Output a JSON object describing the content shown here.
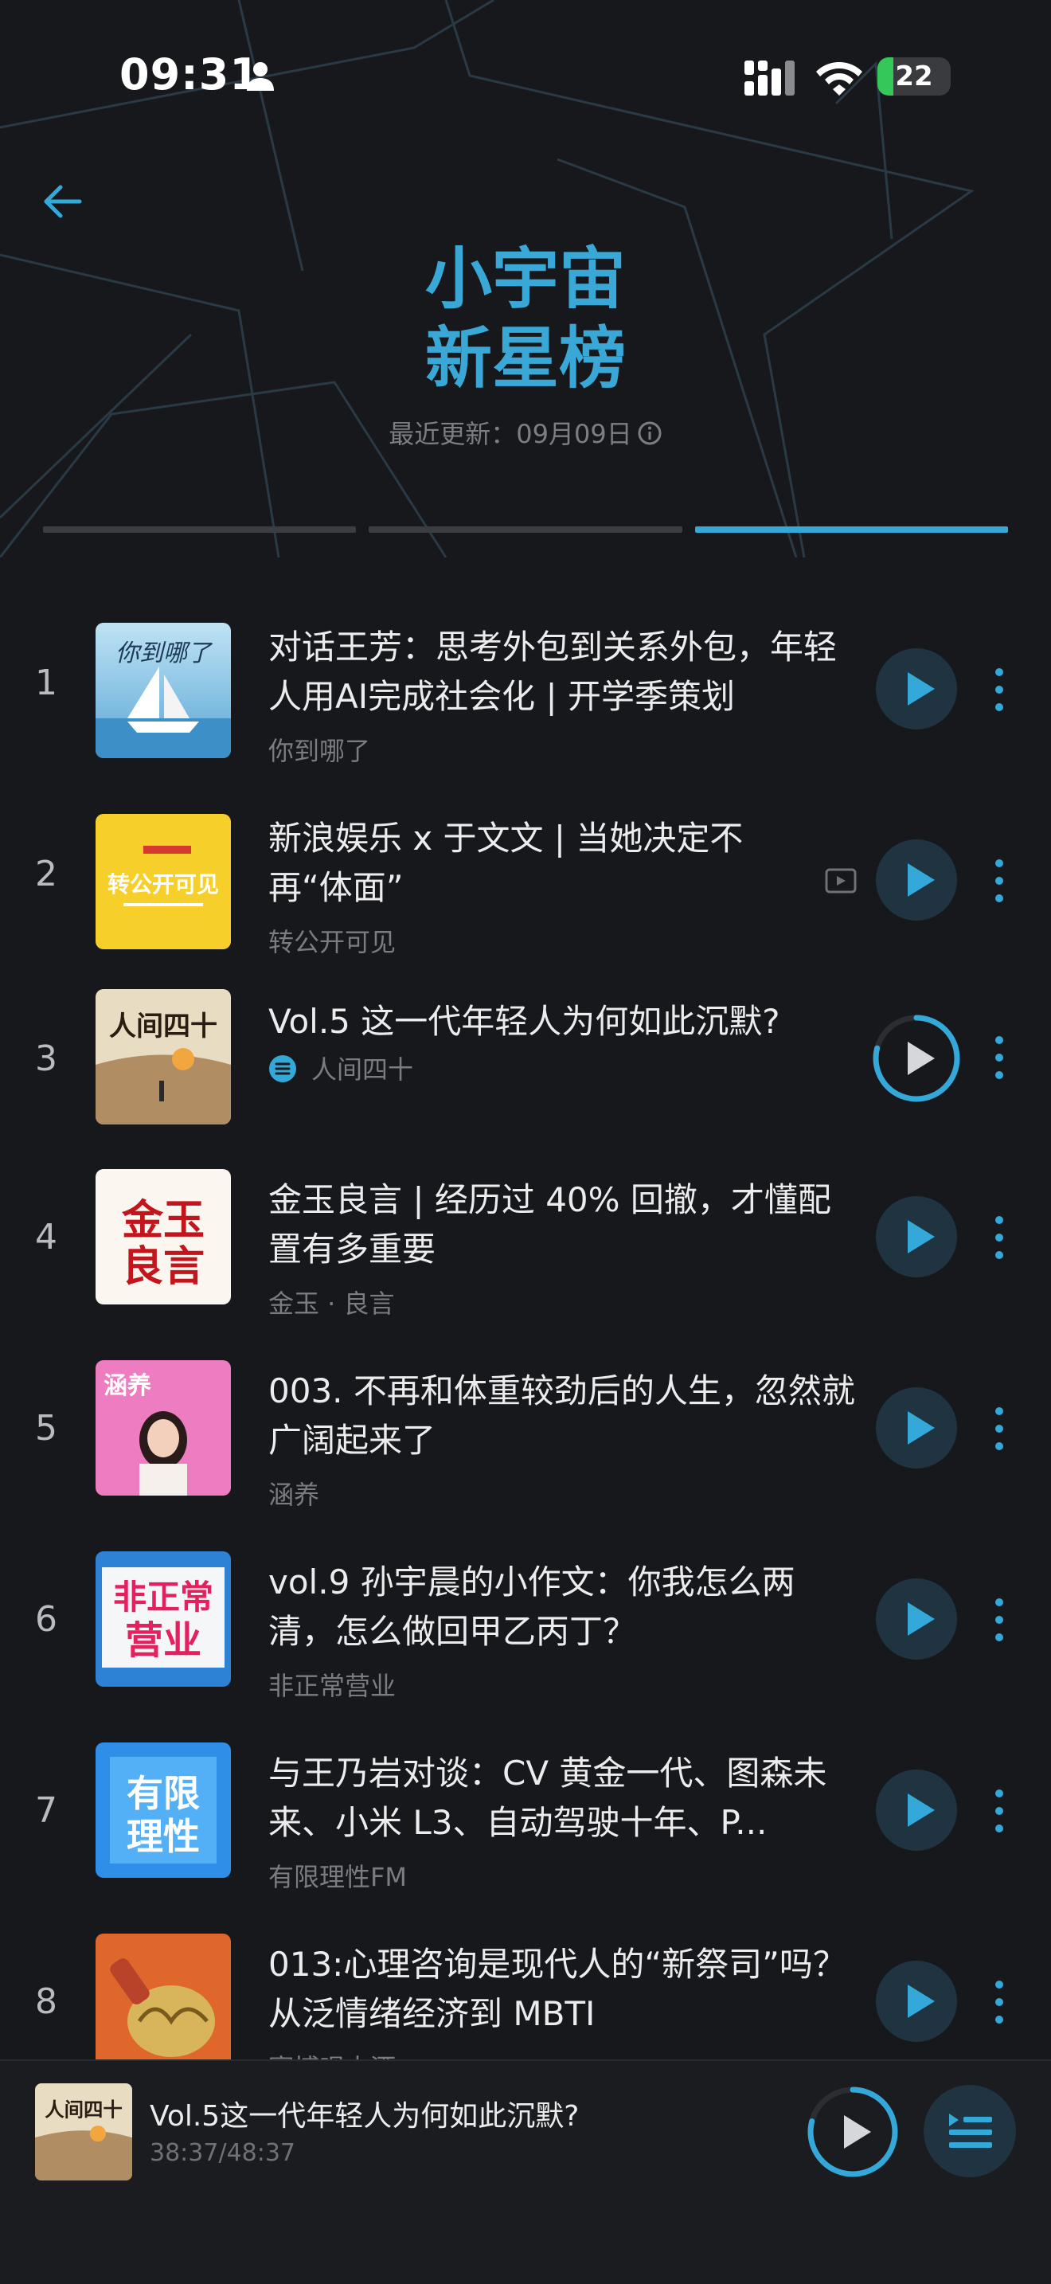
{
  "status_bar": {
    "time": "09:31",
    "battery": "22",
    "battery_level": 0.22
  },
  "header": {
    "title_line1": "小宇宙",
    "title_line2": "新星榜",
    "update_text": "最近更新：09月09日",
    "tabs_count": 3,
    "active_tab": 2
  },
  "colors": {
    "accent": "#34a9d9",
    "background": "#17181c",
    "battery_green": "#35c759"
  },
  "episodes": [
    {
      "rank": "1",
      "title": "对话王芳：思考外包到关系外包，年轻人用AI完成社会化 | 开学季策划",
      "podcast": "你到哪了",
      "cover_text": "你到哪了"
    },
    {
      "rank": "2",
      "title": "新浪娱乐 x 于文文 | 当她决定不再“体面”",
      "podcast": "转公开可见",
      "cover_text": "转公开可见",
      "has_video": true
    },
    {
      "rank": "3",
      "title": "Vol.5 这一代年轻人为何如此沉默?",
      "podcast": "人间四十",
      "cover_text": "人间四十",
      "now_playing": true
    },
    {
      "rank": "4",
      "title": "金玉良言 | 经历过 40% 回撤，才懂配置有多重要",
      "podcast": "金玉 · 良言",
      "cover_text": "金玉良言"
    },
    {
      "rank": "5",
      "title": "003. 不再和体重较劲后的人生，忽然就广阔起来了",
      "podcast": "涵养",
      "cover_text": "涵养"
    },
    {
      "rank": "6",
      "title": "vol.9 孙宇晨的小作文：你我怎么两清，怎么做回甲乙丙丁？",
      "podcast": "非正常营业",
      "cover_text": "非正常营业"
    },
    {
      "rank": "7",
      "title": "与王乃岩对谈：CV 黄金一代、图森未来、小米 L3、自动驾驶十年、P...",
      "podcast": "有限理性FM",
      "cover_text": "有限理性"
    },
    {
      "rank": "8",
      "title": "013:心理咨询是现代人的“新祭司”吗？从泛情绪经济到 MBTI",
      "podcast": "赛博唱大酒",
      "cover_text": ""
    }
  ],
  "mini_player": {
    "title": "Vol.5这一代年轻人为何如此沉默?",
    "time": "38:37/48:37",
    "progress": 0.79
  }
}
